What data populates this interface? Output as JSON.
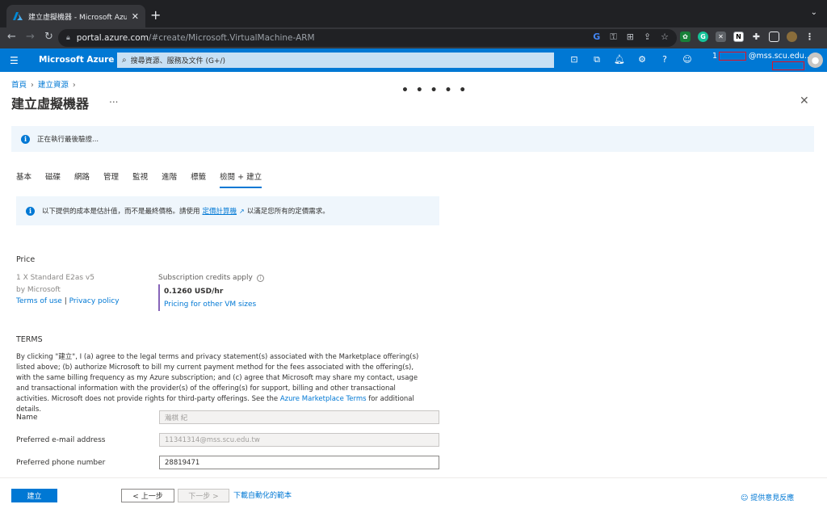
{
  "browser": {
    "tab_title": "建立虛擬機器 - Microsoft Azure",
    "url_host": "portal.azure.com",
    "url_path": "/#create/Microsoft.VirtualMachine-ARM"
  },
  "azure_header": {
    "brand": "Microsoft Azure",
    "search_placeholder": "搜尋資源、服務及文件 (G+/)",
    "account_prefix": "1",
    "account_domain": "@mss.scu.edu..."
  },
  "page": {
    "breadcrumb": [
      "首頁",
      "建立資源"
    ],
    "title": "建立虛擬機器",
    "more": "...",
    "loading_dots": "• • • • •",
    "banner_msg": "正在執行最後驗證..."
  },
  "wizard_tabs": [
    "基本",
    "磁碟",
    "網路",
    "管理",
    "監視",
    "進階",
    "標籤",
    "檢閱 + 建立"
  ],
  "active_tab_index": 7,
  "cost_note": {
    "before": "以下提供的成本是估計值，而不是最終價格。請使用",
    "link": "定價計算機",
    "after": "以滿足您所有的定價需求。"
  },
  "price": {
    "heading": "Price",
    "vm_name": "1 X Standard E2as v5",
    "by": "by Microsoft",
    "terms_link": "Terms of use",
    "sep": " | ",
    "privacy_link": "Privacy policy",
    "credits": "Subscription credits apply",
    "value": "0.1260 USD/hr",
    "other_sizes": "Pricing for other VM sizes"
  },
  "terms": {
    "heading": "TERMS",
    "body_before": "By clicking \"建立\", I (a) agree to the legal terms and privacy statement(s) associated with the Marketplace offering(s) listed above; (b) authorize Microsoft to bill my current payment method for the fees associated with the offering(s), with the same billing frequency as my Azure subscription; and (c) agree that Microsoft may share my contact, usage and transactional information with the provider(s) of the offering(s) for support, billing and other transactional activities. Microsoft does not provide rights for third-party offerings. See the ",
    "link": "Azure Marketplace Terms",
    "body_after": " for additional details."
  },
  "form": {
    "name_label": "Name",
    "name_value": "瀚棋 紀",
    "email_label": "Preferred e-mail address",
    "email_value": "11341314@mss.scu.edu.tw",
    "phone_label": "Preferred phone number",
    "phone_value": "28819471"
  },
  "footer": {
    "create": "建立",
    "prev": "< 上一步",
    "next": "下一步 >",
    "download": "下載自動化的範本",
    "feedback": "提供意見反應"
  },
  "colors": {
    "azure_blue": "#0078d4",
    "chrome_dark": "#202124",
    "chrome_toolbar": "#35363a",
    "highlight_red": "#e81123"
  }
}
